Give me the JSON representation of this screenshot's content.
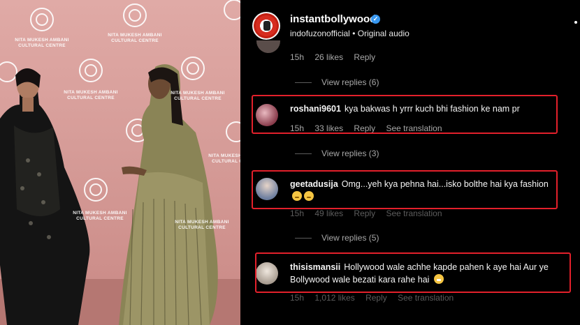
{
  "photo": {
    "backdrop_logo_lines": [
      "NITA MUKESH AMBANI",
      "CULTURAL CENTRE"
    ],
    "backdrop_color": "#d69c98"
  },
  "post": {
    "account": "instantbollywood",
    "verified": true,
    "audio_source": "indofuzonofficial",
    "audio_separator": "•",
    "audio_label": "Original audio"
  },
  "comments": [
    {
      "id": "c0",
      "username": "",
      "text": "",
      "time": "15h",
      "likes": "26 likes",
      "reply_label": "Reply",
      "view_replies": "View replies (6)"
    },
    {
      "id": "c1",
      "username": "roshani9601",
      "text": "kya bakwas h yrrr kuch bhi fashion ke nam pr",
      "time": "15h",
      "likes": "33 likes",
      "reply_label": "Reply",
      "translation": "See translation",
      "view_replies": "View replies (3)",
      "highlighted": true
    },
    {
      "id": "c2",
      "username": "geetadusija",
      "text": "Omg...yeh kya pehna hai...isko bolthe hai kya fashion",
      "emoji_icons": [
        "thinking-face-icon",
        "thinking-face-icon"
      ],
      "time": "15h",
      "likes": "49 likes",
      "reply_label": "Reply",
      "translation": "See translation",
      "view_replies": "View replies (5)",
      "highlighted": true
    },
    {
      "id": "c3",
      "username": "thisismansii",
      "text": "Hollywood wale achhe kapde pahen k aye hai Aur ye Bollywood wale bezati kara rahe hai",
      "emoji_icons": [
        "grinning-face-icon"
      ],
      "time": "15h",
      "likes": "1,012 likes",
      "reply_label": "Reply",
      "translation": "See translation",
      "highlighted": true
    }
  ],
  "colors": {
    "highlight_box": "#e3202b",
    "verified_badge": "#3897f0",
    "meta_text": "#a8a8a8",
    "panel_background": "#000000"
  }
}
